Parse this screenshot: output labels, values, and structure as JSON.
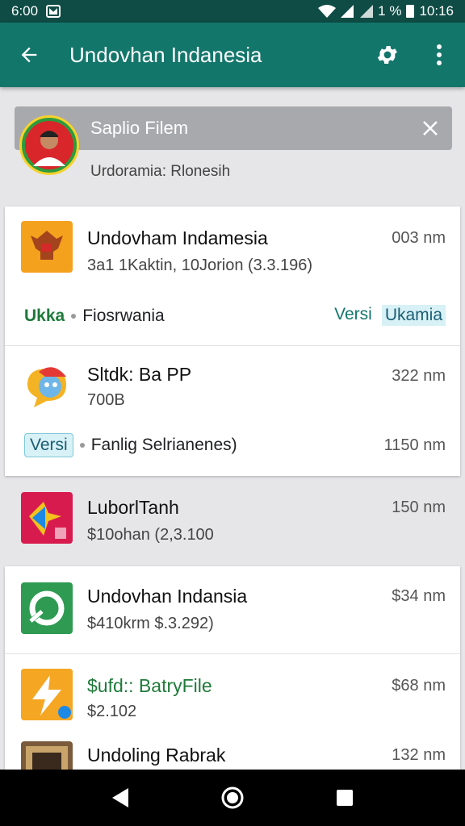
{
  "status_bar": {
    "time": "6:00",
    "right_text": "1  %",
    "clock": "10:16"
  },
  "app_bar": {
    "title": "Undovhan Indanesia"
  },
  "banner": {
    "title": "Saplio Filem",
    "subtitle": "Urdoramia: Rlonesih"
  },
  "apps": [
    {
      "name": "Undovham Indamesia",
      "detail": "3a1 1Kaktin, 10Jorion (3.3.196)",
      "size": "003 nm",
      "meta": {
        "left": "Ukka",
        "middle": "Fiosrwania",
        "right_label": "Versi",
        "right_chip": "Ukamia"
      }
    },
    {
      "name": "Sltdk: Ba PP",
      "detail": "700B",
      "size": "322 nm",
      "meta": {
        "chip": "Versi",
        "middle": "Fanlig Selrianenes)",
        "right": "1150 nm"
      }
    },
    {
      "name": "LuborlTanh",
      "detail": "$10ohan (2,3.100",
      "size": "150 nm"
    },
    {
      "name": "Undovhan Indansia",
      "detail": "$410krm $.3.292)",
      "size": "$34 nm"
    },
    {
      "name": "$ufd:: BatryFile",
      "detail": "$2.102",
      "size": "$68 nm"
    },
    {
      "name": "Undoling Rabrak",
      "detail": "",
      "size": "132 nm"
    }
  ],
  "colors": {
    "appbar": "#13766b",
    "statusbar": "#0f4c45",
    "accent_green": "#1f7a3a"
  }
}
